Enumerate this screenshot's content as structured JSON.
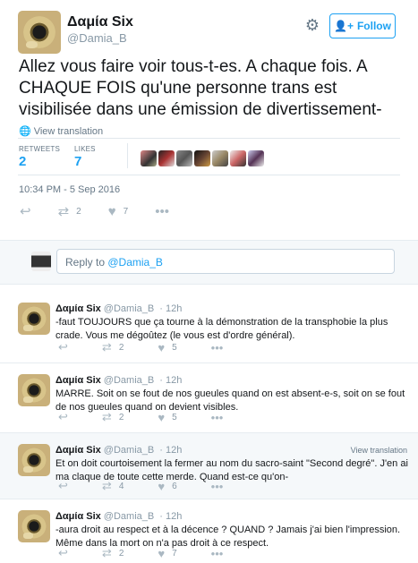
{
  "tweet": {
    "author_name": "Δαμία Six",
    "author_handle": "@Damia_B",
    "follow_label": "Follow",
    "text": "Allez vous faire voir tous-t-es. A chaque fois. A CHAQUE FOIS qu'une personne trans est visibilisée dans une émission de divertissement-",
    "view_translation": "View translation",
    "retweets_label": "RETWEETS",
    "retweets_count": "2",
    "likes_label": "LIKES",
    "likes_count": "7",
    "timestamp": "10:34 PM - 5 Sep 2016",
    "actions": {
      "reply": "",
      "retweet": "2",
      "like": "7"
    }
  },
  "reply_box": {
    "prefix": "Reply to ",
    "handle": "@Damia_B"
  },
  "replies": [
    {
      "name": "Δαμία Six",
      "handle": "@Damia_B",
      "time": "· 12h",
      "text": "-faut TOUJOURS que ça tourne à la démonstration de la transphobie la plus crade. Vous me dégoûtez (le vous est d'ordre général).",
      "retweets": "2",
      "likes": "5",
      "view_translation": ""
    },
    {
      "name": "Δαμία Six",
      "handle": "@Damia_B",
      "time": "· 12h",
      "text": "MARRE. Soit on se fout de nos gueules quand on est absent-e-s, soit on se fout de nos gueules quand on devient visibles.",
      "retweets": "2",
      "likes": "5",
      "view_translation": ""
    },
    {
      "name": "Δαμία Six",
      "handle": "@Damia_B",
      "time": "· 12h",
      "text": "Et on doit courtoisement la fermer au nom du sacro-saint \"Second degré\". J'en ai ma claque de toute cette merde. Quand est-ce qu'on-",
      "retweets": "4",
      "likes": "6",
      "view_translation": "View translation"
    },
    {
      "name": "Δαμία Six",
      "handle": "@Damia_B",
      "time": "· 12h",
      "text": "-aura droit au respect et à la décence ? QUAND ? Jamais j'ai bien l'impression. Même dans la mort on n'a pas droit à ce respect.",
      "retweets": "2",
      "likes": "7",
      "view_translation": ""
    }
  ],
  "colors": {
    "accent": "#1da1f2",
    "muted": "#657786",
    "border": "#e1e8ed"
  },
  "icons": [
    "gear-icon",
    "add-user-icon",
    "globe-icon",
    "reply-icon",
    "retweet-icon",
    "like-icon",
    "more-icon"
  ]
}
